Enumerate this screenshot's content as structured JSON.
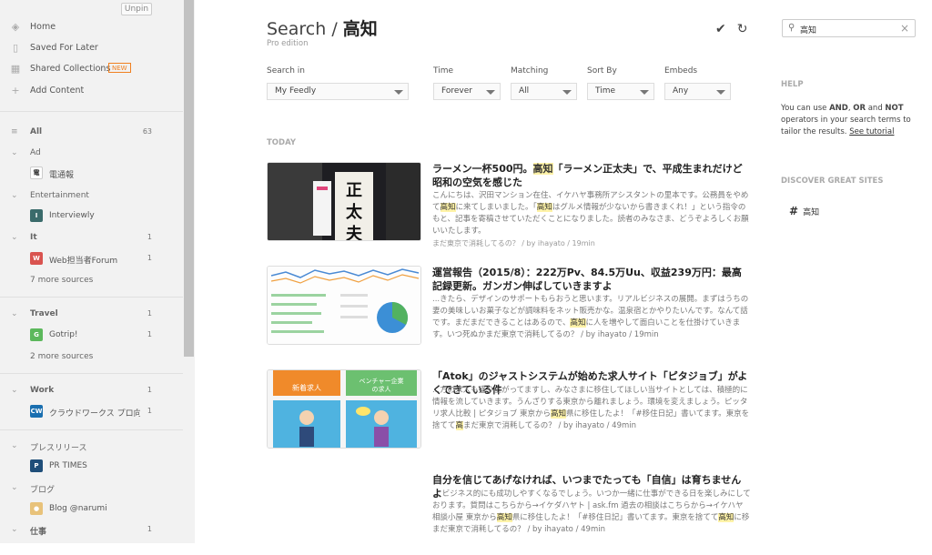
{
  "sidebar": {
    "unpin_label": "Unpin",
    "nav": [
      {
        "label": "Home",
        "icon": "home-icon"
      },
      {
        "label": "Saved For Later",
        "icon": "bookmark-icon"
      },
      {
        "label": "Shared Collections",
        "icon": "collections-icon",
        "badge": "NEW"
      },
      {
        "label": "Add Content",
        "icon": "plus-icon"
      }
    ],
    "all_label": "All",
    "all_count": "63",
    "categories": [
      {
        "name": "Ad",
        "count": "",
        "sources": [
          {
            "name": "電通報",
            "count": ""
          }
        ]
      },
      {
        "name": "Entertainment",
        "count": "",
        "sources": [
          {
            "name": "Interviewly",
            "count": ""
          }
        ]
      },
      {
        "name": "It",
        "count": "1",
        "sources": [
          {
            "name": "Web担当者Forum",
            "count": "1"
          }
        ],
        "more": "7 more sources"
      },
      {
        "name": "Travel",
        "count": "1",
        "sources": [
          {
            "name": "Gotrip!",
            "count": "1"
          }
        ],
        "more": "2 more sources"
      },
      {
        "name": "Work",
        "count": "1",
        "sources": [
          {
            "name": "クラウドワークス プロ向け...",
            "count": "1"
          }
        ]
      },
      {
        "name": "プレスリリース",
        "count": "",
        "sources": [
          {
            "name": "PR TIMES",
            "count": ""
          }
        ]
      },
      {
        "name": "ブログ",
        "count": "",
        "sources": [
          {
            "name": "Blog @narumi",
            "count": ""
          }
        ]
      },
      {
        "name": "仕事",
        "count": "1",
        "sources": []
      }
    ]
  },
  "header": {
    "title_prefix": "Search / ",
    "title_query": "高知",
    "subtitle": "Pro edition"
  },
  "filters": {
    "search_in": {
      "label": "Search in",
      "value": "My Feedly"
    },
    "time": {
      "label": "Time",
      "value": "Forever"
    },
    "matching": {
      "label": "Matching",
      "value": "All"
    },
    "sort_by": {
      "label": "Sort By",
      "value": "Time"
    },
    "embeds": {
      "label": "Embeds",
      "value": "Any"
    }
  },
  "section_today": "TODAY",
  "articles": [
    {
      "title_pre": "ラーメン一杯500円。",
      "title_hl": "高知",
      "title_post": "「ラーメン正太夫」で、平成生まれだけど昭和の空気を感じた",
      "snip_pre": "こんにちは、沢田マンション在住、イケハヤ事務所アシスタントの里本です。公務員をやめて",
      "snip_hl1": "高知",
      "snip_mid": "に来てしまいました。「",
      "snip_hl2": "高知",
      "snip_post": "はグルメ情報が少ないから書きまくれ！」という指令のもと、記事を寄稿させていただくことになりました。読者のみなさま、どうぞよろしくお願いいたします。",
      "meta": "まだ東京で消耗してるの？ / by ihayato / 19min"
    },
    {
      "title_pre": "運営報告（2015/8）：222万Pv、84.5万Uu、収益239万円：最高記録更新。ガンガン伸ばしていきますよ",
      "title_hl": "",
      "title_post": "",
      "snip_pre": "...きたら、デザインのサポートもらおうと思います。リアルビジネスの展開。まずはうちの妻の美味しいお菓子などが調味料をネット販売かな。温泉宿とかやりたいんです。なんて話です。まだまだできることはあるので、",
      "snip_hl1": "高知",
      "snip_mid": "に人を増やして面白いことを仕掛けていきます。いつ死ぬかまだ東京で消耗してるの？ / by ihayato / 19min",
      "snip_hl2": "",
      "snip_post": "",
      "meta": ""
    },
    {
      "title_pre": "「Atok」のジャストシステムが始めた求人サイト「ピタジョブ」がよくできている件",
      "title_hl": "",
      "title_post": "",
      "snip_pre": "...方の求人も盛り上がってますし、みなさまに移住してほしい当サイトとしては、積極的に情報を流していきます。うんざりする東京から離れましょう。環境を変えましょう。ピッタリ求人比較 | ピタジョブ 東京から",
      "snip_hl1": "高知",
      "snip_mid": "県に移住したよ！「#移住日記」書いてます。東京を捨てて",
      "snip_hl2": "高",
      "snip_post": "まだ東京で消耗してるの？ / by ihayato / 49min",
      "meta": ""
    },
    {
      "title_pre": "自分を信じてあげなければ、いつまでたっても「自信」は育ちませんよ",
      "title_hl": "",
      "title_post": "",
      "snip_pre": "... ビジネス的にも成功しやすくなるでしょう。いつか一緒に仕事ができる日を楽しみにしております。質問はこちらから→イケダハヤト | ask.fm 過去の相談はこちらから→イケハヤ相談小屋 東京から",
      "snip_hl1": "高知",
      "snip_mid": "県に移住したよ！「#移住日記」書いてます。東京を捨てて",
      "snip_hl2": "高知",
      "snip_post": "に移まだ東京で消耗してるの？ / by ihayato / 49min",
      "meta": ""
    }
  ],
  "right": {
    "search_value": "高知",
    "help_heading": "HELP",
    "help_pre": "You can use ",
    "help_and": "AND",
    "help_sep1": ", ",
    "help_or": "OR",
    "help_sep2": " and ",
    "help_not": "NOT",
    "help_post": " operators in your search terms to tailor the results. ",
    "help_link": "See tutorial",
    "discover_heading": "DISCOVER GREAT SITES",
    "discover_tag": "高知"
  }
}
